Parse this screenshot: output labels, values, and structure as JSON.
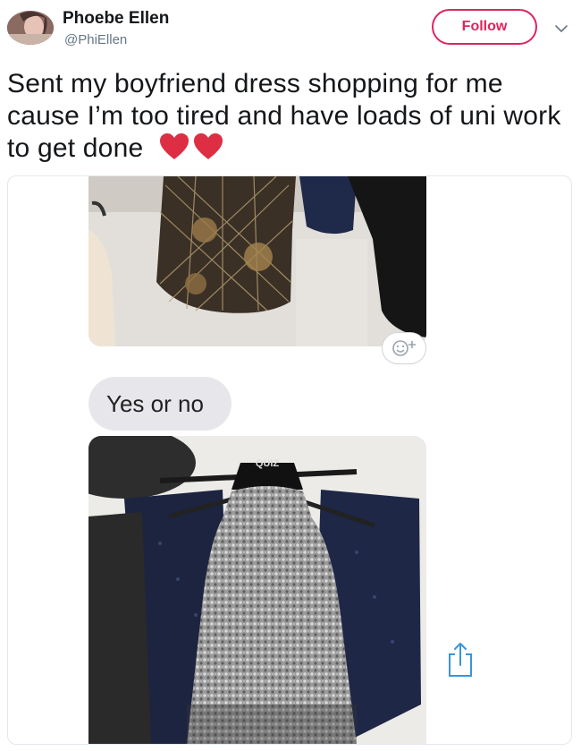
{
  "tweet": {
    "author_name": "Phoebe Ellen",
    "author_handle": "@PhiEllen",
    "follow_label": "Follow",
    "text": "Sent my boyfriend dress shopping for me cause I’m too tired and have loads of uni work to get done",
    "emoji": [
      "heart-icon",
      "heart-icon"
    ]
  },
  "media": {
    "message_text": "Yes or no",
    "photo_logo": "QUIZ",
    "icons": [
      "add-reaction-icon",
      "share-icon"
    ]
  },
  "colors": {
    "follow_accent": "#e0245e",
    "handle_gray": "#657786",
    "heart_red": "#dd2e44",
    "bubble_gray": "#e7e6eb",
    "share_blue": "#3b94d9"
  }
}
